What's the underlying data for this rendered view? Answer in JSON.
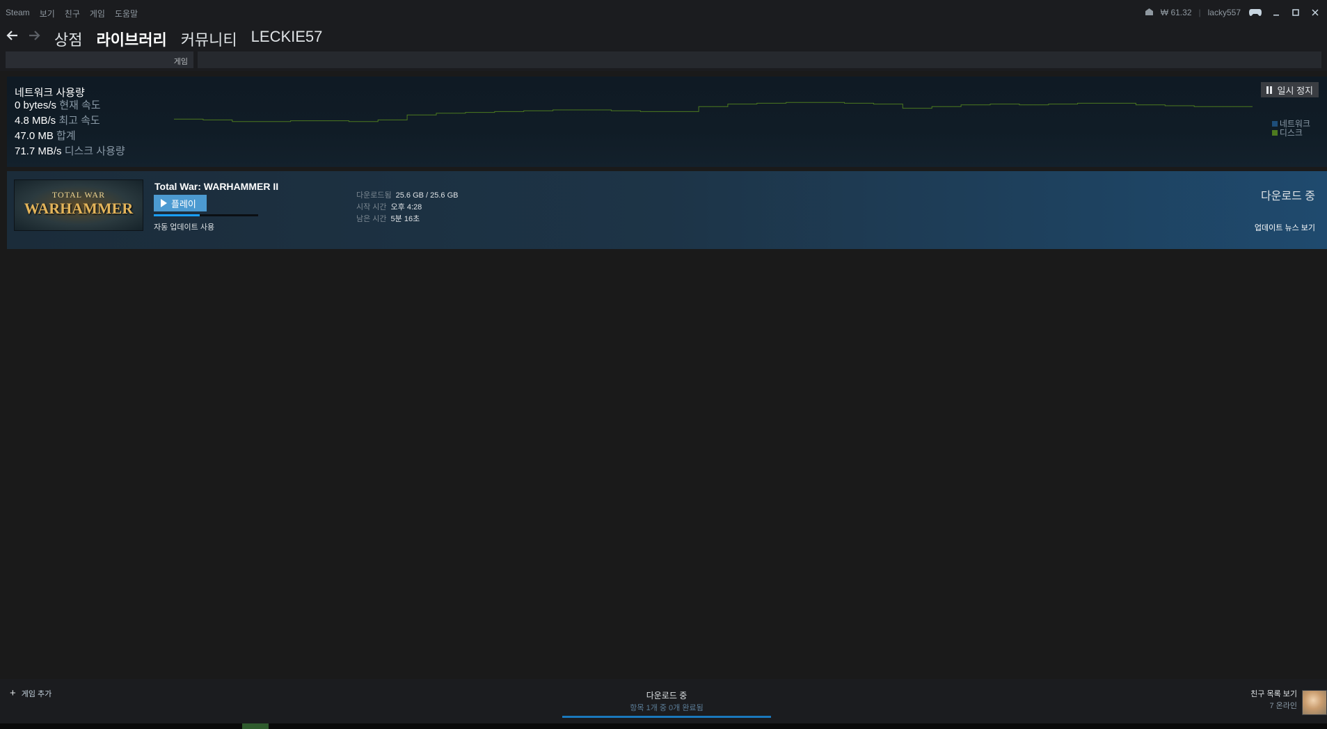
{
  "menu": [
    "Steam",
    "보기",
    "친구",
    "게임",
    "도움말"
  ],
  "account": {
    "wallet": "₩ 61.32",
    "username": "lacky557"
  },
  "nav": {
    "links": [
      "상점",
      "라이브러리",
      "커뮤니티",
      "LECKIE57"
    ],
    "active": "라이브러리"
  },
  "search": {
    "label": "게임"
  },
  "network": {
    "title": "네트워크 사용량",
    "stats": [
      {
        "value": "0 bytes/s",
        "label": "현재 속도"
      },
      {
        "value": "4.8 MB/s",
        "label": "최고 속도"
      },
      {
        "value": "47.0 MB",
        "label": "합계"
      },
      {
        "value": "71.7 MB/s",
        "label": "디스크 사용량"
      }
    ],
    "pause_label": "일시 정지",
    "legend": [
      {
        "name": "네트워크",
        "color": "#1e4e7a"
      },
      {
        "name": "디스크",
        "color": "#4d7a1f"
      }
    ],
    "disk_series": [
      2.4,
      2.3,
      2.1,
      2.1,
      2.2,
      2.2,
      2.1,
      2.3,
      2.9,
      3.1,
      3.2,
      3.3,
      3.4,
      3.5,
      3.5,
      3.4,
      3.3,
      3.3,
      3.9,
      4.2,
      4.3,
      4.4,
      4.4,
      4.3,
      4.2,
      3.7,
      3.9,
      4.1,
      4.2,
      4.1,
      4.2,
      4.3,
      4.3,
      4.1,
      4.0,
      3.9,
      3.9
    ],
    "graph_color": "#4d7a1f"
  },
  "download": {
    "game_title": "Total War: WARHAMMER II",
    "capsule_line1": "TOTAL WAR",
    "capsule_line2": "WARHAMMER",
    "play_label": "플레이",
    "progress": 0.44,
    "auto_update": "자동 업데이트 사용",
    "info": [
      {
        "key": "다운로드됨",
        "value": "25.6 GB / 25.6 GB"
      },
      {
        "key": "시작 시간",
        "value": "오후 4:28"
      },
      {
        "key": "남은 시간",
        "value": "5분 16초"
      }
    ],
    "status": "다운로드 중",
    "news_link": "업데이트 뉴스 보기"
  },
  "bottom": {
    "add_game": "게임 추가",
    "dl_title": "다운로드 중",
    "dl_sub": "항목 1개 중 0개 완료됨",
    "friends_title": "친구 목록 보기",
    "friends_online": "7 온라인"
  }
}
